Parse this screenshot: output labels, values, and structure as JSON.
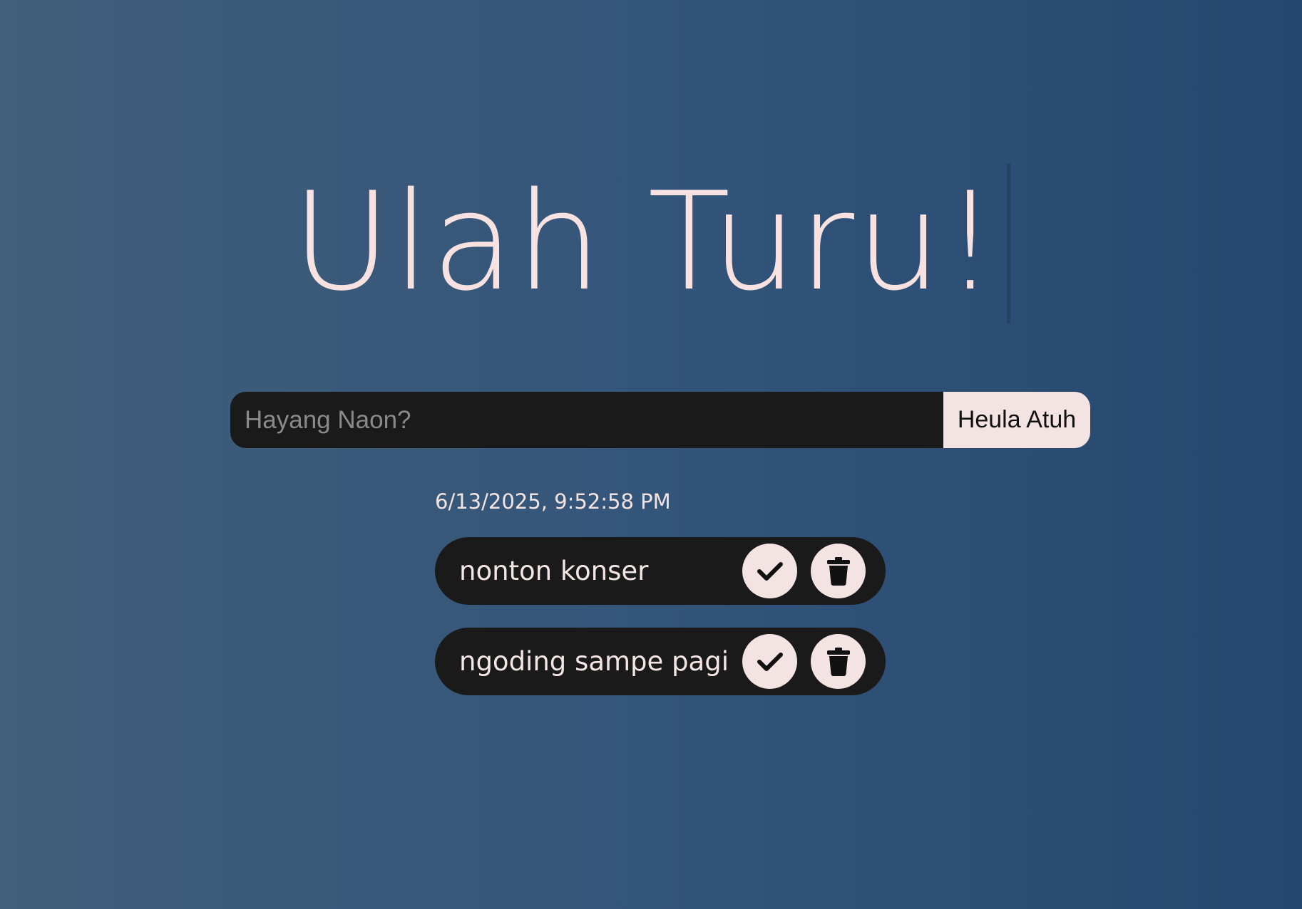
{
  "page": {
    "title": "Ulah Turu!"
  },
  "form": {
    "input_placeholder": "Hayang Naon?",
    "input_value": "",
    "submit_label": "Heula Atuh"
  },
  "datetime": "6/13/2025, 9:52:58 PM",
  "todos": [
    {
      "text": "nonton konser",
      "complete_icon": "check-icon",
      "delete_icon": "trash-icon"
    },
    {
      "text": "ngoding sampe pagi",
      "complete_icon": "check-icon",
      "delete_icon": "trash-icon"
    }
  ],
  "colors": {
    "background_start": "#415e7a",
    "background_end": "#25476f",
    "title": "#f7e2e1",
    "dark_surface": "#1a1a1a",
    "light_surface": "#f3e3e2"
  }
}
